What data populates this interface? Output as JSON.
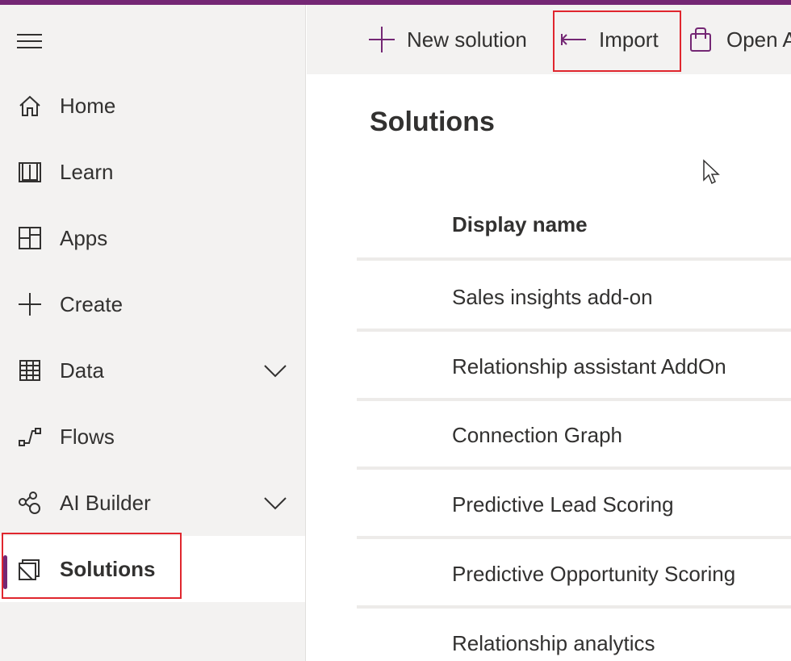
{
  "colors": {
    "accent": "#742774",
    "highlight": "#e0262e",
    "sidebar_bg": "#f3f2f1"
  },
  "sidebar": {
    "menu_icon": "hamburger-icon",
    "items": [
      {
        "label": "Home",
        "icon": "home-icon"
      },
      {
        "label": "Learn",
        "icon": "book-icon"
      },
      {
        "label": "Apps",
        "icon": "apps-icon"
      },
      {
        "label": "Create",
        "icon": "plus-icon"
      },
      {
        "label": "Data",
        "icon": "table-icon",
        "expandable": true
      },
      {
        "label": "Flows",
        "icon": "flow-icon"
      },
      {
        "label": "AI Builder",
        "icon": "ai-builder-icon",
        "expandable": true
      },
      {
        "label": "Solutions",
        "icon": "solutions-icon",
        "active": true
      }
    ]
  },
  "commandbar": {
    "new_solution": "New solution",
    "import": "Import",
    "open": "Open A"
  },
  "main": {
    "title": "Solutions",
    "column_header": "Display name",
    "rows": [
      "Sales insights add-on",
      "Relationship assistant AddOn",
      "Connection Graph",
      "Predictive Lead Scoring",
      "Predictive Opportunity Scoring",
      "Relationship analytics"
    ]
  }
}
